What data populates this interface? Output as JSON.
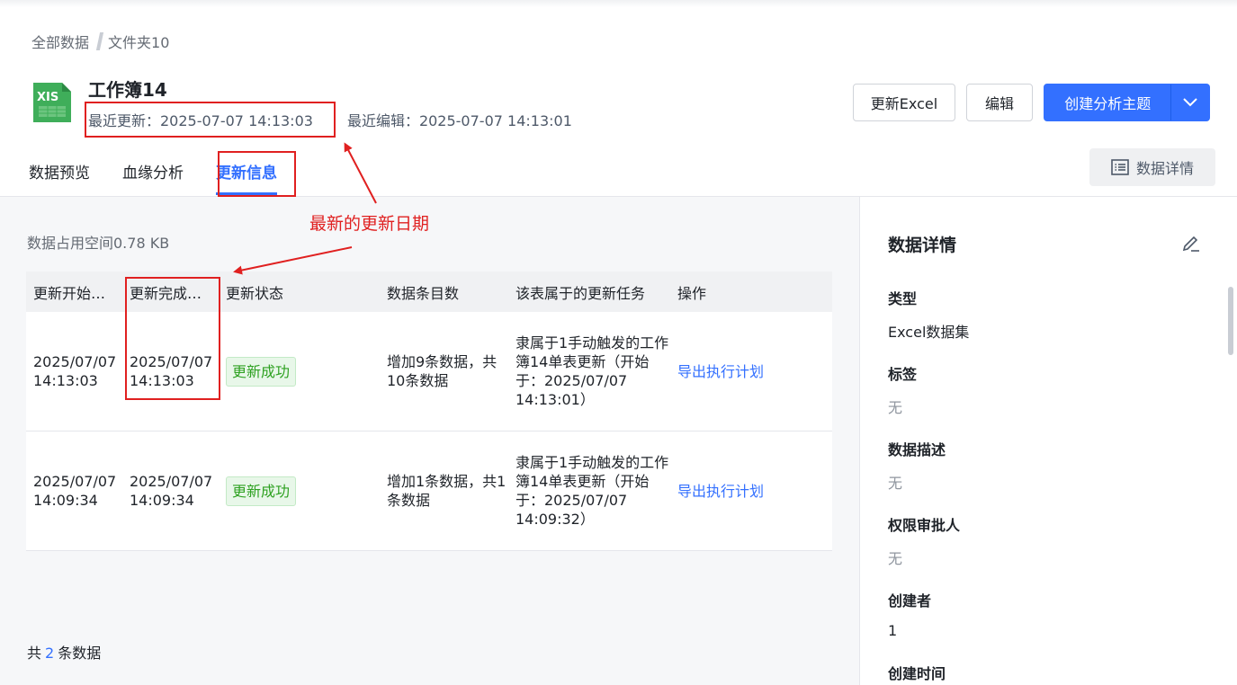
{
  "breadcrumb": {
    "root": "全部数据",
    "current": "文件夹10"
  },
  "header": {
    "icon_text": "XIS",
    "title": "工作簿14",
    "last_update": "最近更新：2025-07-07 14:13:03",
    "last_edit": "最近编辑：2025-07-07 14:13:01"
  },
  "buttons": {
    "update_excel": "更新Excel",
    "edit": "编辑",
    "create_topic": "创建分析主题",
    "data_detail": "数据详情"
  },
  "tabs": [
    {
      "label": "数据预览",
      "active": false
    },
    {
      "label": "血缘分析",
      "active": false
    },
    {
      "label": "更新信息",
      "active": true
    }
  ],
  "main": {
    "space": "数据占用空间0.78 KB",
    "columns": [
      "更新开始…",
      "更新完成…",
      "更新状态",
      "数据条目数",
      "该表属于的更新任务",
      "操作"
    ],
    "rows": [
      {
        "start": "2025/07/07 14:13:03",
        "end": "2025/07/07 14:13:03",
        "status": "更新成功",
        "count": "增加9条数据，共10条数据",
        "task": "隶属于1手动触发的工作簿14单表更新（开始于：2025/07/07 14:13:01）",
        "action": "导出执行计划"
      },
      {
        "start": "2025/07/07 14:09:34",
        "end": "2025/07/07 14:09:34",
        "status": "更新成功",
        "count": "增加1条数据，共1条数据",
        "task": "隶属于1手动触发的工作簿14单表更新（开始于：2025/07/07 14:09:32）",
        "action": "导出执行计划"
      }
    ],
    "total_prefix": "共",
    "total_count": "2",
    "total_suffix": "条数据"
  },
  "detail": {
    "title": "数据详情",
    "items": [
      {
        "label": "类型",
        "value": "Excel数据集"
      },
      {
        "label": "标签",
        "value": "无"
      },
      {
        "label": "数据描述",
        "value": "无"
      },
      {
        "label": "权限审批人",
        "value": "无"
      },
      {
        "label": "创建者",
        "value": "1"
      },
      {
        "label": "创建时间",
        "value": ""
      }
    ]
  },
  "annotation": {
    "text": "最新的更新日期",
    "color": "#e02020"
  },
  "colors": {
    "accent": "#3370ff",
    "success": "#2ea121"
  }
}
